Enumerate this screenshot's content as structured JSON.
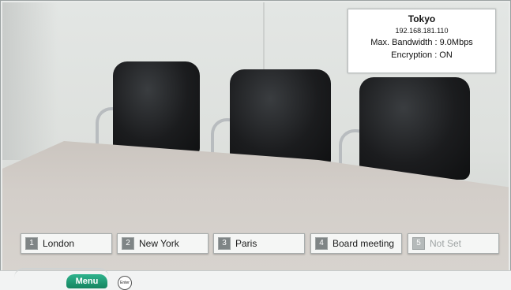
{
  "status_panel": {
    "site_name": "Tokyo",
    "ip_address": "192.168.181.110",
    "bandwidth": "Max. Bandwidth : 9.0Mbps",
    "encryption": "Encryption : ON"
  },
  "speed_dial": [
    {
      "number": "1",
      "label": "London"
    },
    {
      "number": "2",
      "label": "New York"
    },
    {
      "number": "3",
      "label": "Paris"
    },
    {
      "number": "4",
      "label": "Board meeting"
    },
    {
      "number": "5",
      "label": "Not Set"
    }
  ],
  "bottom_bar": {
    "menu_label": "Menu",
    "enter_label": "Enter"
  },
  "colors": {
    "menu_button": "#1e9c74",
    "panel_background": "#ffffff"
  },
  "icons": {
    "enter": "enter-button-icon"
  }
}
